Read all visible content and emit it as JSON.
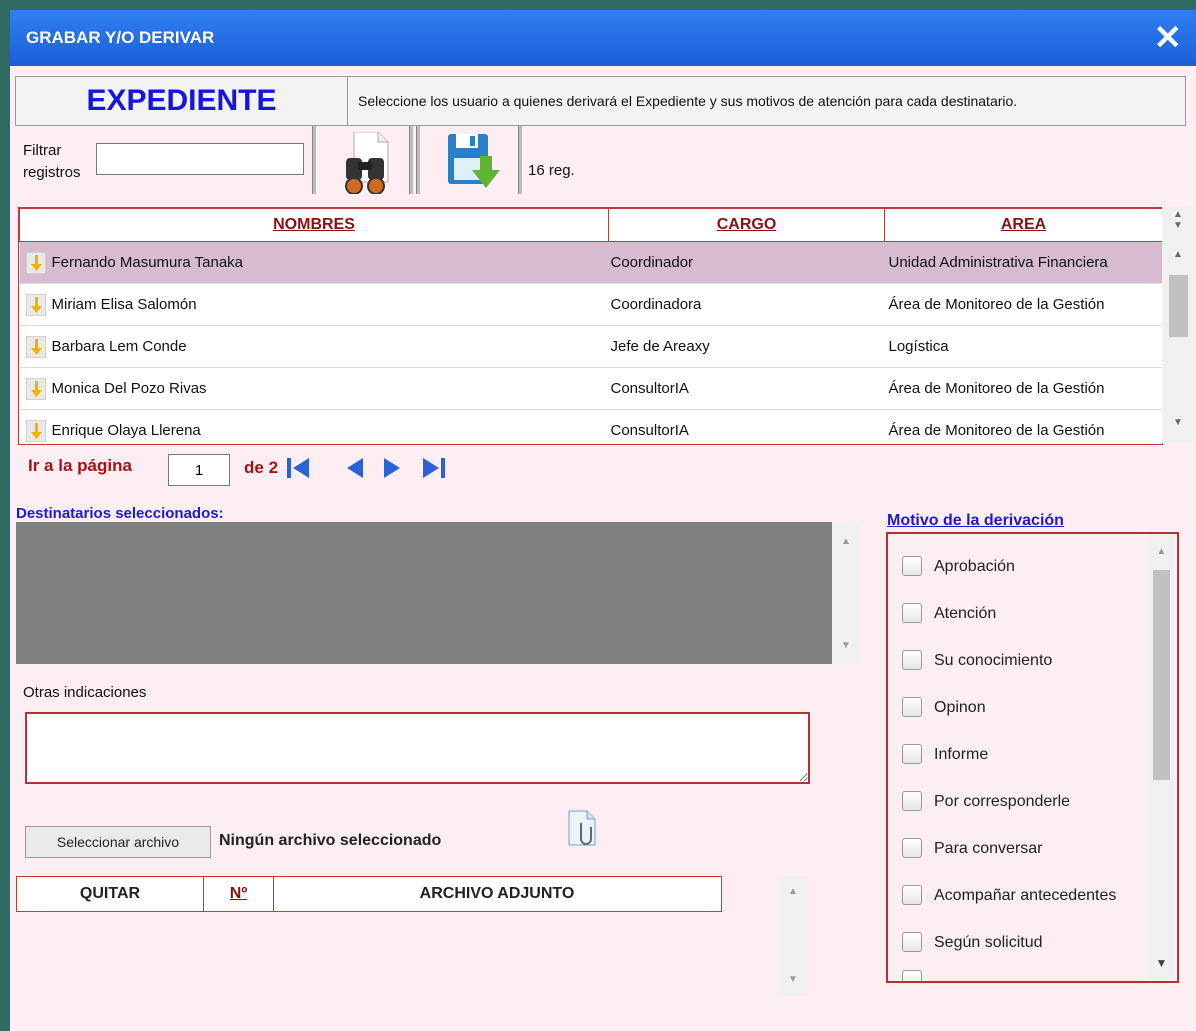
{
  "dialog": {
    "title": "GRABAR Y/O DERIVAR",
    "close": "✕"
  },
  "header": {
    "label": "EXPEDIENTE",
    "description": "Seleccione los usuario a quienes derivará el Expediente y sus motivos de atención para cada destinatario."
  },
  "filter": {
    "label_1": "Filtrar",
    "label_2": "registros",
    "value": "",
    "record_count": "16 reg."
  },
  "table": {
    "columns": [
      "NOMBRES",
      "CARGO",
      "AREA"
    ],
    "rows": [
      {
        "name": "Fernando Masumura Tanaka",
        "cargo": "Coordinador",
        "area": "Unidad Administrativa Financiera",
        "selected": true
      },
      {
        "name": "Miriam Elisa Salomón",
        "cargo": "Coordinadora",
        "area": "Área de Monitoreo de la Gestión",
        "selected": false
      },
      {
        "name": "Barbara Lem Conde",
        "cargo": "Jefe de Areaxy",
        "area": "Logística",
        "selected": false
      },
      {
        "name": "Monica Del Pozo Rivas",
        "cargo": "ConsultorIA",
        "area": "Área de Monitoreo de la Gestión",
        "selected": false
      },
      {
        "name": "Enrique Olaya Llerena",
        "cargo": "ConsultorIA",
        "area": "Área de Monitoreo de la Gestión",
        "selected": false
      }
    ]
  },
  "pager": {
    "label": "Ir a la página",
    "page": "1",
    "of_label": "de",
    "total": "2"
  },
  "destinatarios": {
    "label": "Destinatarios seleccionados:"
  },
  "otras": {
    "label": "Otras indicaciones",
    "value": ""
  },
  "file": {
    "button": "Seleccionar archivo",
    "status": "Ningún archivo seleccionado"
  },
  "attachments": {
    "columns": [
      "QUITAR",
      "Nº",
      "ARCHIVO ADJUNTO"
    ]
  },
  "motivo": {
    "label": "Motivo de la derivación",
    "options": [
      "Aprobación",
      "Atención",
      "Su conocimiento",
      "Opinon",
      "Informe",
      "Por corresponderle",
      "Para conversar",
      "Acompañar antecedentes",
      "Según solicitud"
    ]
  },
  "colors": {
    "title_bar": "#1b5fd8",
    "accent_red": "#b53030",
    "selected_row": "#d7bcd1",
    "panel_bg": "#fdeef3"
  }
}
